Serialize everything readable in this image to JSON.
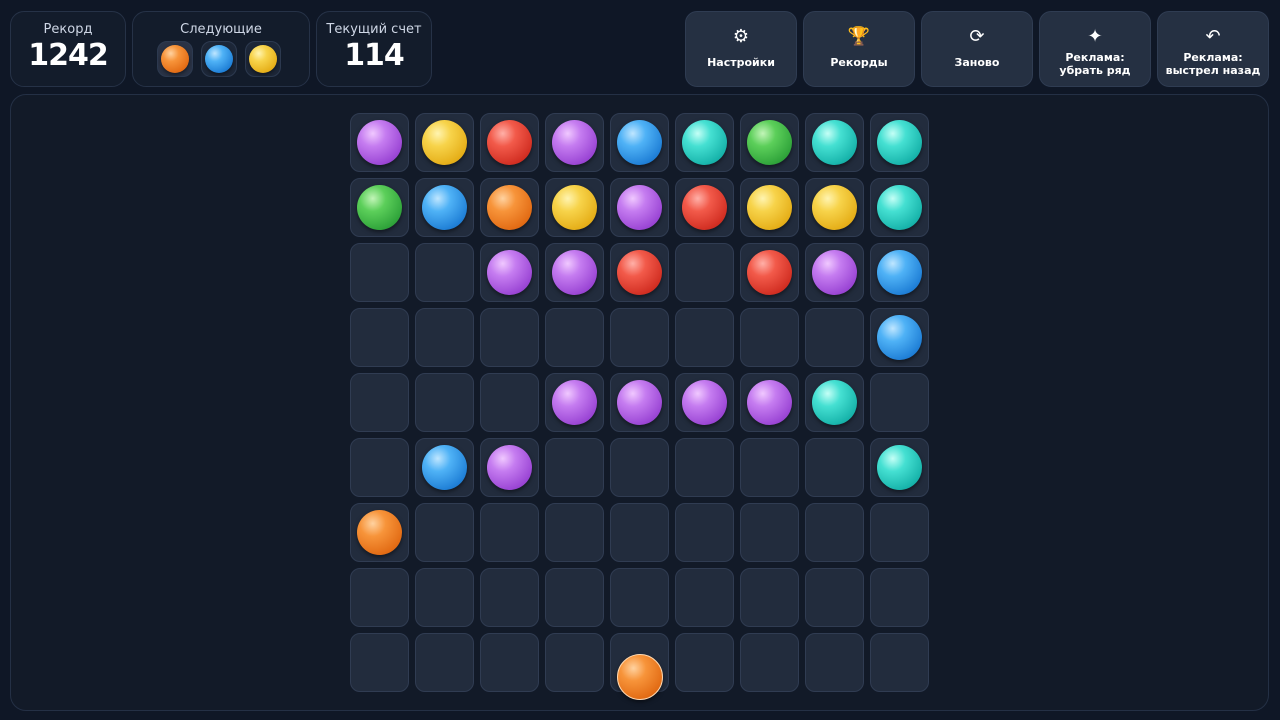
{
  "stats": {
    "record_label": "Рекорд",
    "record_value": "1242",
    "next_label": "Следующие",
    "score_label": "Текущий счет",
    "score_value": "114"
  },
  "next_balls": [
    "orange",
    "blue",
    "yellow"
  ],
  "buttons": [
    {
      "icon": "⚙",
      "icon_name": "gear-icon",
      "label": "Настройки"
    },
    {
      "icon": "🏆",
      "icon_name": "trophy-icon",
      "label": "Рекорды"
    },
    {
      "icon": "⟳",
      "icon_name": "restart-icon",
      "label": "Заново"
    },
    {
      "icon": "✦",
      "icon_name": "sparkle-icon",
      "label": "Реклама: убрать ряд"
    },
    {
      "icon": "↶",
      "icon_name": "undo-icon",
      "label": "Реклама: выстрел назад"
    }
  ],
  "board": {
    "rows": 9,
    "cols": 9,
    "cells": [
      [
        "purple",
        "yellow",
        "red",
        "purple",
        "blue",
        "cyan",
        "green",
        "cyan",
        "cyan"
      ],
      [
        "green",
        "blue",
        "orange",
        "yellow",
        "purple",
        "red",
        "yellow",
        "yellow",
        "cyan"
      ],
      [
        "",
        "",
        "purple",
        "purple",
        "red",
        "",
        "red",
        "purple",
        "blue"
      ],
      [
        "",
        "",
        "",
        "",
        "",
        "",
        "",
        "",
        "blue"
      ],
      [
        "",
        "",
        "",
        "purple",
        "purple",
        "purple",
        "purple",
        "cyan",
        ""
      ],
      [
        "",
        "blue",
        "purple",
        "",
        "",
        "",
        "",
        "",
        "cyan"
      ],
      [
        "orange",
        "",
        "",
        "",
        "",
        "",
        "",
        "",
        ""
      ],
      [
        "",
        "",
        "",
        "",
        "",
        "",
        "",
        "",
        ""
      ],
      [
        "",
        "",
        "",
        "",
        "",
        "",
        "",
        "",
        ""
      ]
    ]
  },
  "shooter_ball": "orange",
  "colors": {
    "purple": "#b36be6",
    "yellow": "#f2c232",
    "red": "#e4443a",
    "blue": "#3498ea",
    "cyan": "#2fcfc3",
    "green": "#44b948",
    "orange": "#f0801f",
    "background": "#0f1726"
  }
}
